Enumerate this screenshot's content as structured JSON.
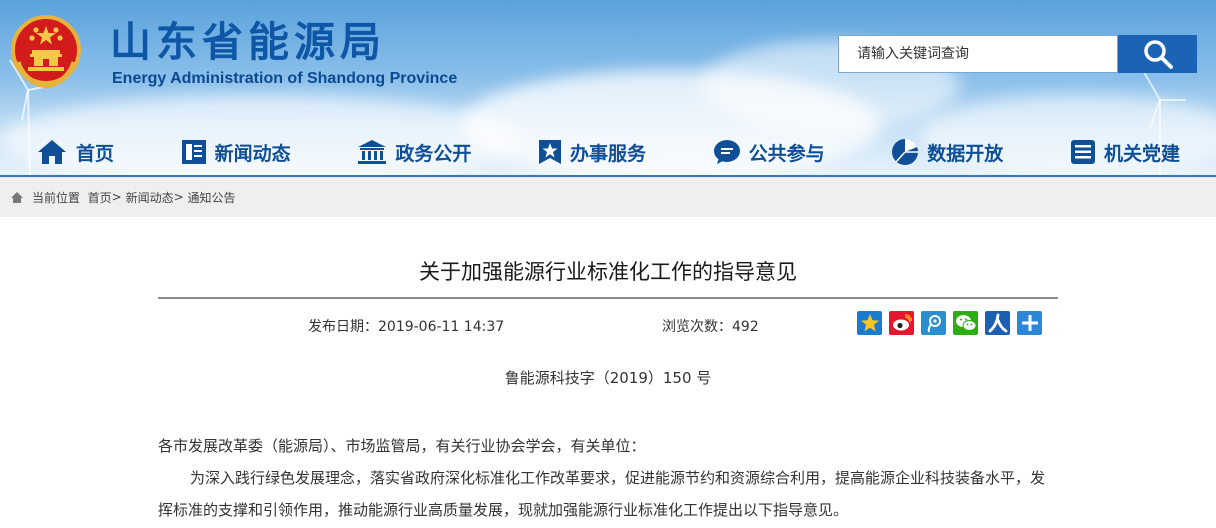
{
  "header": {
    "title": "山东省能源局",
    "subtitle": "Energy Administration of Shandong Province",
    "colors": {
      "title": "#0e57a6",
      "nav_text": "#0e4f98",
      "search_button": "#1a63b5"
    }
  },
  "search": {
    "placeholder": "请输入关键词查询",
    "icon": "search-icon"
  },
  "nav": {
    "items": [
      {
        "label": "首页",
        "icon": "home-icon"
      },
      {
        "label": "新闻动态",
        "icon": "newspaper-icon"
      },
      {
        "label": "政务公开",
        "icon": "government-building-icon"
      },
      {
        "label": "办事服务",
        "icon": "star-badge-icon"
      },
      {
        "label": "公共参与",
        "icon": "chat-bubble-icon"
      },
      {
        "label": "数据开放",
        "icon": "pie-chart-icon"
      },
      {
        "label": "机关党建",
        "icon": "document-list-icon"
      }
    ]
  },
  "breadcrumb": {
    "current_label": "当前位置",
    "items": [
      "首页",
      "新闻动态",
      "通知公告"
    ],
    "separator": ">"
  },
  "article": {
    "title": "关于加强能源行业标准化工作的指导意见",
    "date_label": "发布日期：",
    "date": "2019-06-11 14:37",
    "views_label": "浏览次数：",
    "views": "492",
    "doc_number": "鲁能源科技字（2019）150 号",
    "greeting": "各市发展改革委（能源局）、市场监管局，有关行业协会学会，有关单位：",
    "paragraph1": "为深入践行绿色发展理念，落实省政府深化标准化工作改革要求，促进能源节约和资源综合利用，提高能源企业科技装备水平，发挥标准的支撑和引领作用，推动能源行业高质量发展，现就加强能源行业标准化工作提出以下指导意见。"
  },
  "share": {
    "items": [
      {
        "name": "qzone",
        "icon": "qzone-star-icon",
        "color": "#1a7bd1"
      },
      {
        "name": "weibo",
        "icon": "weibo-icon",
        "color": "#e6162d"
      },
      {
        "name": "tencent-weibo",
        "icon": "tencent-weibo-icon",
        "color": "#2a8fcf"
      },
      {
        "name": "wechat",
        "icon": "wechat-icon",
        "color": "#2bad13"
      },
      {
        "name": "renren",
        "icon": "renren-icon",
        "color": "#1c5fb3"
      },
      {
        "name": "more",
        "icon": "plus-icon",
        "color": "#2e86d6"
      }
    ]
  }
}
